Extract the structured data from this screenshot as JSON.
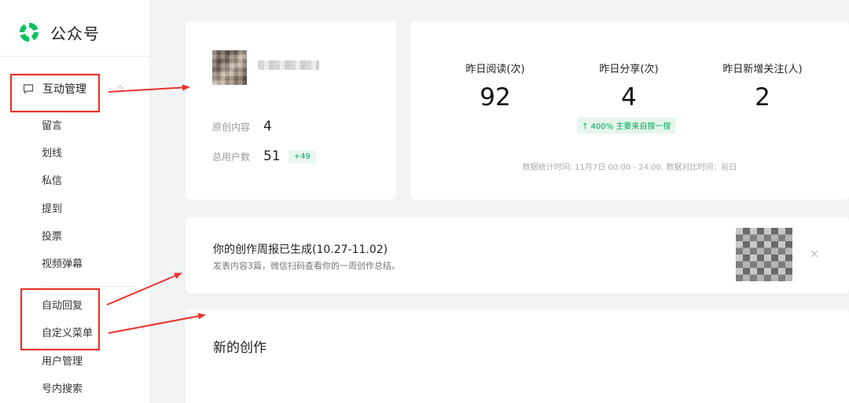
{
  "app": {
    "name": "公众号"
  },
  "sidebar": {
    "group_label": "互动管理",
    "items": [
      {
        "label": "留言"
      },
      {
        "label": "划线"
      },
      {
        "label": "私信"
      },
      {
        "label": "提到"
      },
      {
        "label": "投票"
      },
      {
        "label": "视频弹幕"
      },
      {
        "label": "自动回复"
      },
      {
        "label": "自定义菜单"
      },
      {
        "label": "用户管理"
      },
      {
        "label": "号内搜索"
      }
    ]
  },
  "profile": {
    "original_label": "原创内容",
    "original_value": "4",
    "users_label": "总用户数",
    "users_value": "51",
    "users_delta": "+49"
  },
  "metrics": {
    "reads_label": "昨日阅读(次)",
    "reads_value": "92",
    "shares_label": "昨日分享(次)",
    "shares_value": "4",
    "shares_trend": "↑ 400%   主要来自搜一搜",
    "follows_label": "昨日新增关注(人)",
    "follows_value": "2",
    "footnote": "数据统计时间: 11月7日 00:00 - 24:00, 数据对比时间：前日"
  },
  "weekly": {
    "title": "你的创作周报已生成(10.27-11.02)",
    "desc": "发表内容3篇，微信扫码查看你的一周创作总结。"
  },
  "creation": {
    "title": "新的创作"
  },
  "colors": {
    "accent_green": "#07c160",
    "annotation_red": "#e8332a"
  }
}
